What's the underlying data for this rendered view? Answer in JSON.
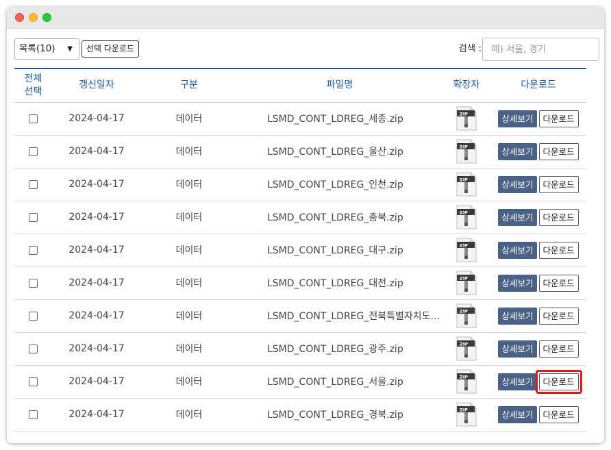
{
  "toolbar": {
    "page_size_value": "목록(10)",
    "bulk_download_label": "선택 다운로드",
    "search_label": "검색 :",
    "search_placeholder": "예) 서울, 경기"
  },
  "table": {
    "headers": {
      "select_all": "전체\n선택",
      "date": "갱신일자",
      "category": "구분",
      "filename": "파일명",
      "extension": "확장자",
      "download": "다운로드"
    },
    "detail_label": "상세보기",
    "download_label": "다운로드",
    "extension_icon": "zip-file-icon",
    "rows": [
      {
        "date": "2024-04-17",
        "category": "데이터",
        "filename": "LSMD_CONT_LDREG_세종.zip"
      },
      {
        "date": "2024-04-17",
        "category": "데이터",
        "filename": "LSMD_CONT_LDREG_울산.zip"
      },
      {
        "date": "2024-04-17",
        "category": "데이터",
        "filename": "LSMD_CONT_LDREG_인천.zip"
      },
      {
        "date": "2024-04-17",
        "category": "데이터",
        "filename": "LSMD_CONT_LDREG_충북.zip"
      },
      {
        "date": "2024-04-17",
        "category": "데이터",
        "filename": "LSMD_CONT_LDREG_대구.zip"
      },
      {
        "date": "2024-04-17",
        "category": "데이터",
        "filename": "LSMD_CONT_LDREG_대전.zip"
      },
      {
        "date": "2024-04-17",
        "category": "데이터",
        "filename": "LSMD_CONT_LDREG_전북특별자치도.zi…"
      },
      {
        "date": "2024-04-17",
        "category": "데이터",
        "filename": "LSMD_CONT_LDREG_광주.zip"
      },
      {
        "date": "2024-04-17",
        "category": "데이터",
        "filename": "LSMD_CONT_LDREG_서울.zip",
        "highlighted": true
      },
      {
        "date": "2024-04-17",
        "category": "데이터",
        "filename": "LSMD_CONT_LDREG_경북.zip"
      }
    ]
  },
  "colors": {
    "header_text": "#1c5a97",
    "detail_button": "#4a6285",
    "highlight": "#d51b1b"
  }
}
